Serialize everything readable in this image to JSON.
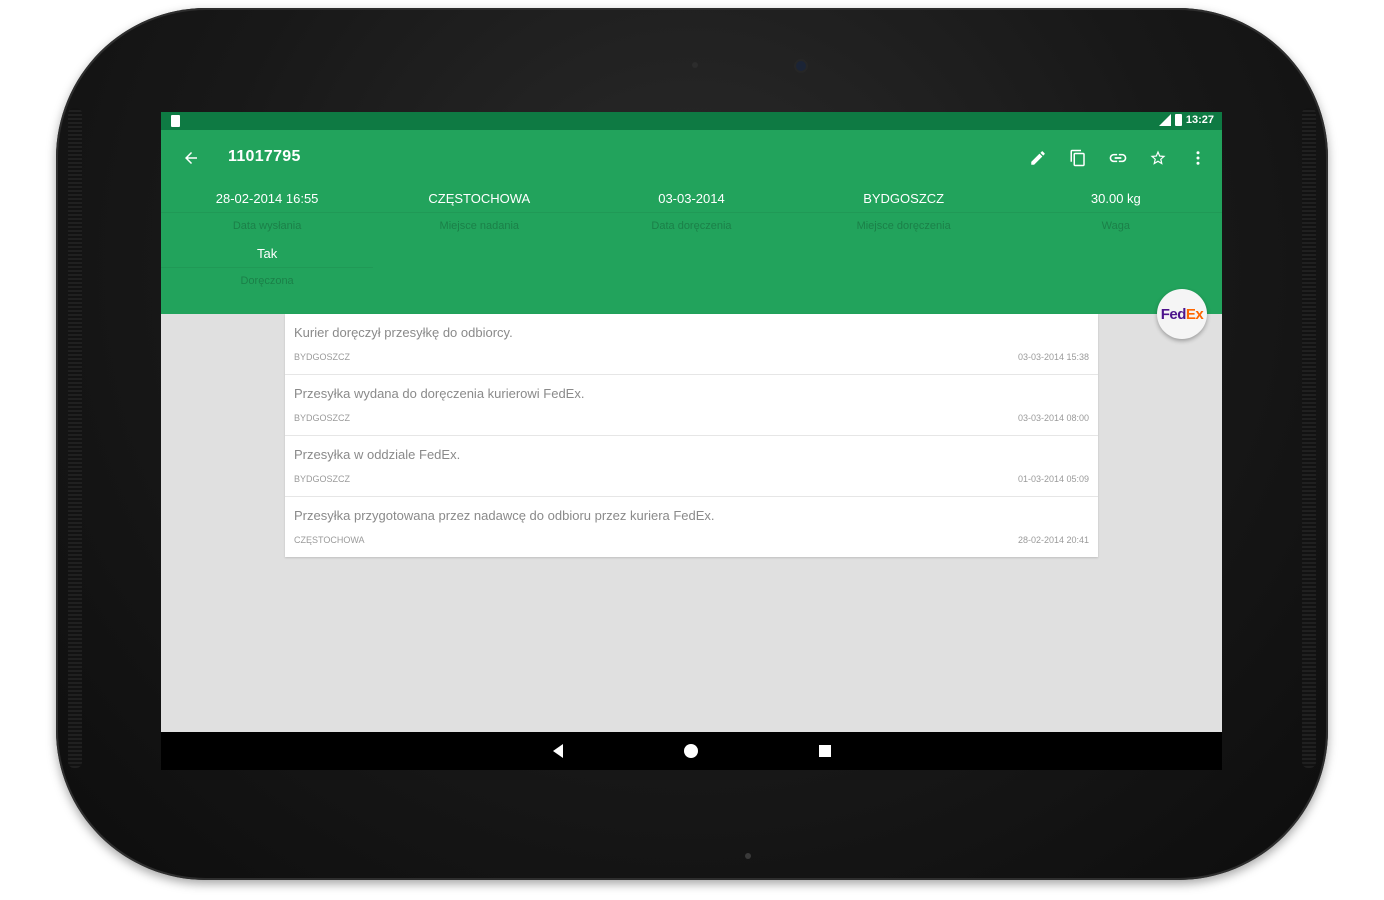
{
  "status_bar": {
    "time": "13:27"
  },
  "toolbar": {
    "title": "11017795",
    "icons": [
      "back-arrow-icon",
      "edit-icon",
      "copy-icon",
      "link-icon",
      "star-icon",
      "more-vert-icon"
    ]
  },
  "details": {
    "row1": [
      {
        "value": "28-02-2014 16:55",
        "label": "Data wysłania"
      },
      {
        "value": "CZĘSTOCHOWA",
        "label": "Miejsce nadania"
      },
      {
        "value": "03-03-2014",
        "label": "Data doręczenia"
      },
      {
        "value": "BYDGOSZCZ",
        "label": "Miejsce doręczenia"
      },
      {
        "value": "30.00 kg",
        "label": "Waga"
      }
    ],
    "row2": [
      {
        "value": "Tak",
        "label": "Doręczona"
      }
    ]
  },
  "carrier_logo": {
    "part1": "Fed",
    "part2": "Ex"
  },
  "events": [
    {
      "description": "Kurier doręczył przesyłkę do odbiorcy.",
      "place": "BYDGOSZCZ",
      "time": "03-03-2014 15:38"
    },
    {
      "description": "Przesyłka wydana do doręczenia kurierowi FedEx.",
      "place": "BYDGOSZCZ",
      "time": "03-03-2014 08:00"
    },
    {
      "description": "Przesyłka w oddziale FedEx.",
      "place": "BYDGOSZCZ",
      "time": "01-03-2014 05:09"
    },
    {
      "description": "Przesyłka przygotowana przez nadawcę do odbioru przez kuriera FedEx.",
      "place": "CZĘSTOCHOWA",
      "time": "28-02-2014 20:41"
    }
  ],
  "colors": {
    "primary": "#22a35c",
    "primary_dark": "#0e7a43",
    "background": "#e0e0e0",
    "fedex_purple": "#4d148c",
    "fedex_orange": "#ff6600"
  }
}
